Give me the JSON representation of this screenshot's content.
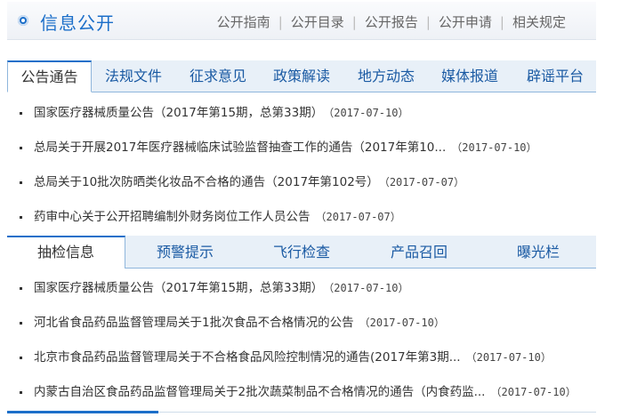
{
  "header": {
    "title": "信息公开",
    "nav": [
      "公开指南",
      "公开目录",
      "公开报告",
      "公开申请",
      "相关规定"
    ]
  },
  "tabs1": [
    "公告通告",
    "法规文件",
    "征求意见",
    "政策解读",
    "地方动态",
    "媒体报道",
    "辟谣平台"
  ],
  "list1": [
    {
      "title": "国家医疗器械质量公告（2017年第15期，总第33期）",
      "date": "（2017-07-10）"
    },
    {
      "title": "总局关于开展2017年医疗器械临床试验监督抽查工作的通告（2017年第10...",
      "date": "（2017-07-10）"
    },
    {
      "title": "总局关于10批次防晒类化妆品不合格的通告（2017年第102号）",
      "date": "（2017-07-07）"
    },
    {
      "title": "药审中心关于公开招聘编制外财务岗位工作人员公告",
      "date": "（2017-07-07）"
    }
  ],
  "tabs2": [
    "抽检信息",
    "预警提示",
    "飞行检查",
    "产品召回",
    "曝光栏"
  ],
  "list2": [
    {
      "title": "国家医疗器械质量公告（2017年第15期，总第33期）",
      "date": "（2017-07-10）"
    },
    {
      "title": "河北省食品药品监督管理局关于1批次食品不合格情况的公告",
      "date": "（2017-07-10）"
    },
    {
      "title": "北京市食品药品监督管理局关于不合格食品风险控制情况的通告(2017年第3期...",
      "date": "（2017-07-10）"
    },
    {
      "title": "内蒙古自治区食品药品监督管理局关于2批次蔬菜制品不合格情况的通告（内食药监...",
      "date": "（2017-07-10）"
    }
  ]
}
